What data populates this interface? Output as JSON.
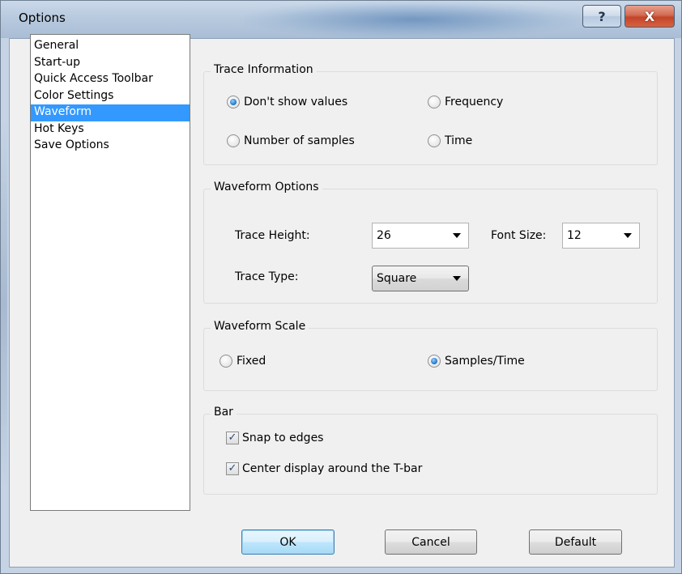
{
  "window": {
    "title": "Options",
    "help_label": "?",
    "close_label": "X"
  },
  "nav": {
    "items": [
      {
        "label": "General",
        "selected": false
      },
      {
        "label": "Start-up",
        "selected": false
      },
      {
        "label": "Quick Access Toolbar",
        "selected": false
      },
      {
        "label": "Color Settings",
        "selected": false
      },
      {
        "label": "Waveform",
        "selected": true
      },
      {
        "label": "Hot Keys",
        "selected": false
      },
      {
        "label": "Save Options",
        "selected": false
      }
    ]
  },
  "trace_information": {
    "title": "Trace Information",
    "dont_show_values": "Don't show values",
    "frequency": "Frequency",
    "number_of_samples": "Number of samples",
    "time": "Time",
    "selected": "Don't show values"
  },
  "waveform_options": {
    "title": "Waveform Options",
    "trace_height_label": "Trace Height:",
    "trace_height_value": "26",
    "font_size_label": "Font Size:",
    "font_size_value": "12",
    "trace_type_label": "Trace Type:",
    "trace_type_value": "Square"
  },
  "waveform_scale": {
    "title": "Waveform Scale",
    "fixed": "Fixed",
    "samples_time": "Samples/Time",
    "selected": "Samples/Time"
  },
  "bar": {
    "title": "Bar",
    "snap_to_edges": "Snap to edges",
    "snap_checked": true,
    "center_display": "Center display around the T-bar",
    "center_checked": true
  },
  "buttons": {
    "ok": "OK",
    "cancel": "Cancel",
    "default": "Default"
  },
  "colors": {
    "selection": "#3399ff",
    "radio_selected": "#1e6fc4"
  }
}
